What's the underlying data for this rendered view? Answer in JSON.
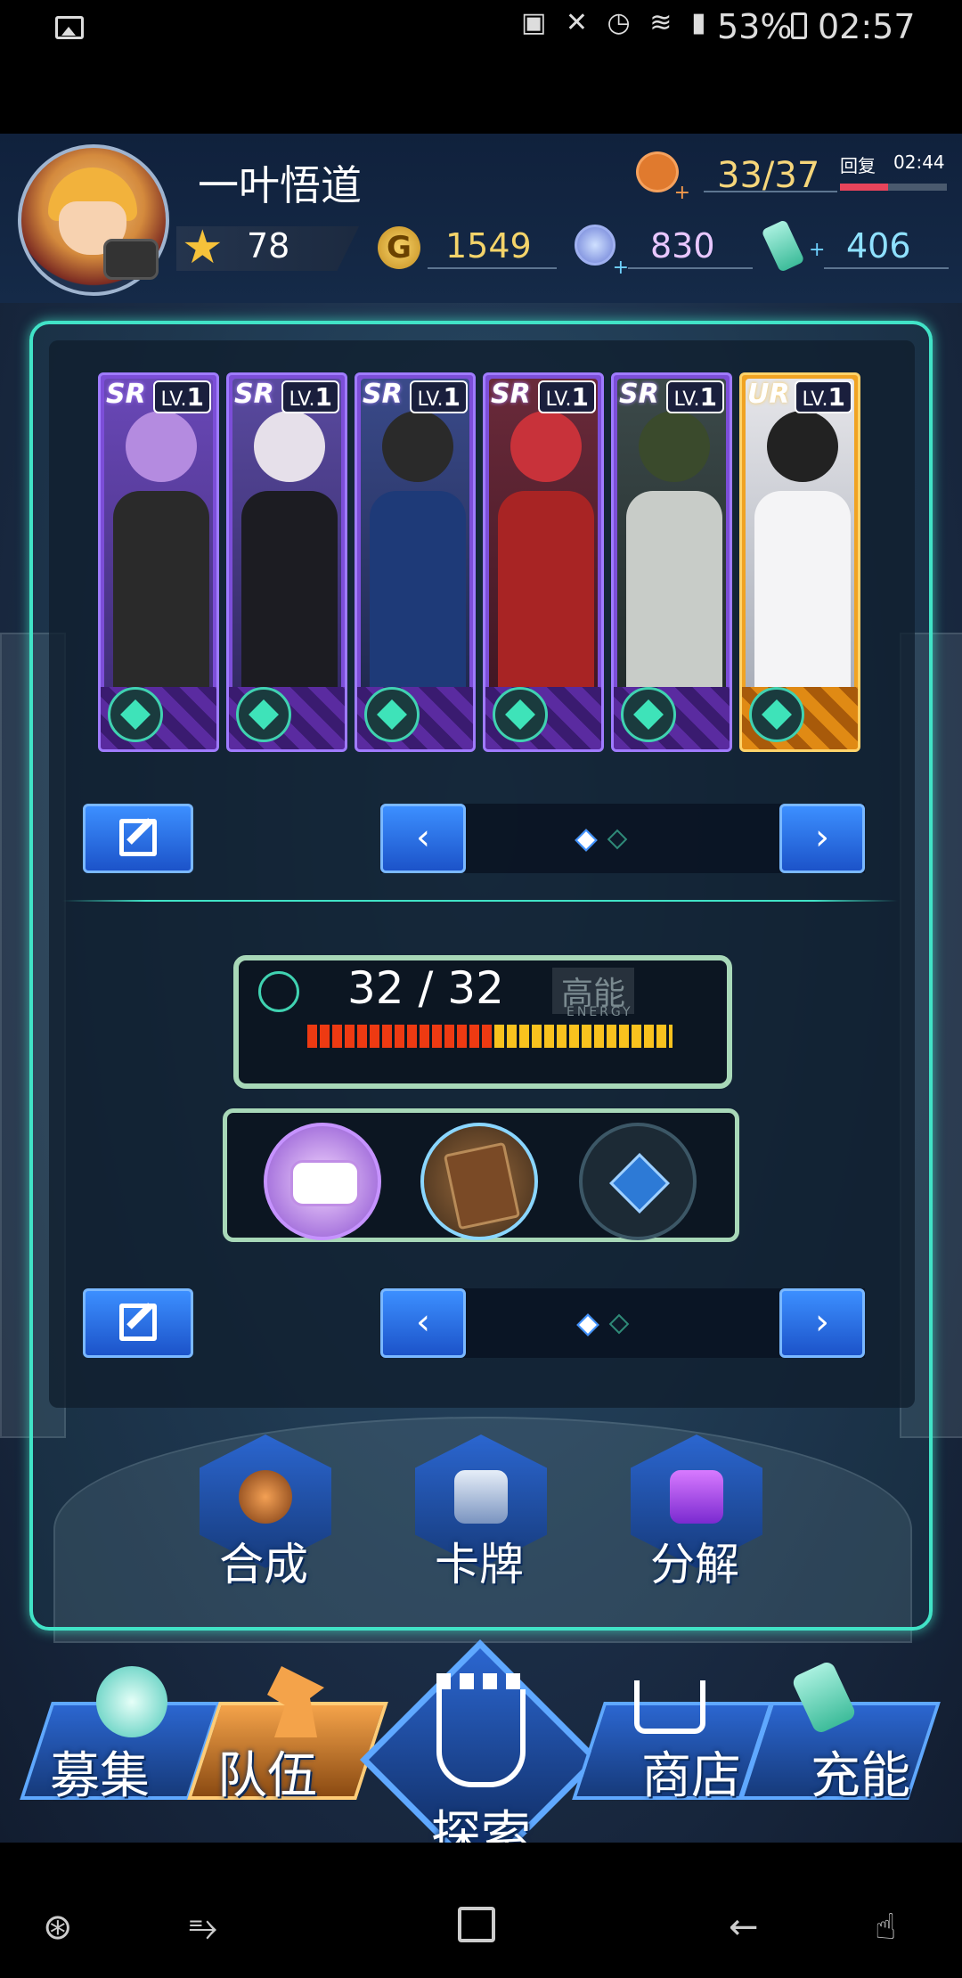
{
  "status_bar": {
    "battery": "53%",
    "time": "02:57",
    "icons": [
      "gallery-icon",
      "screenshot-icon",
      "mute-icon",
      "alarm-icon",
      "wifi-icon",
      "4g-signal-icon",
      "battery-icon"
    ]
  },
  "header": {
    "player_name": "一叶悟道",
    "stamina": "33/37",
    "recover_label": "回复",
    "recover_time": "02:44",
    "recover_progress": 0.45,
    "level_stars": "78",
    "gold": "1549",
    "gems": "830",
    "energy_items": "406"
  },
  "team": {
    "cards": [
      {
        "rarity": "SR",
        "level_prefix": "LV.",
        "level": "1"
      },
      {
        "rarity": "SR",
        "level_prefix": "LV.",
        "level": "1"
      },
      {
        "rarity": "SR",
        "level_prefix": "LV.",
        "level": "1"
      },
      {
        "rarity": "SR",
        "level_prefix": "LV.",
        "level": "1"
      },
      {
        "rarity": "SR",
        "level_prefix": "LV.",
        "level": "1"
      },
      {
        "rarity": "UR",
        "level_prefix": "LV.",
        "level": "1"
      }
    ],
    "pager_prev": "‹",
    "pager_next": "›",
    "page_index": 1,
    "page_count": 2
  },
  "energy": {
    "count": "32 / 32",
    "tag": "高能",
    "tag_sub": "ENERGY",
    "fill": 1.0
  },
  "equipment": {
    "slots": [
      "game-console-icon",
      "book-icon",
      "lock-icon"
    ],
    "pager_prev": "‹",
    "pager_next": "›"
  },
  "actions": {
    "synthesize": "合成",
    "cards": "卡牌",
    "decompose": "分解"
  },
  "nav": {
    "recruit": "募集",
    "team": "队伍",
    "explore": "探索",
    "shop": "商店",
    "recharge": "充能",
    "active": "team"
  },
  "colors": {
    "accent": "#41e3c7",
    "button_blue": "#2b66d0",
    "active_tab": "#f4a34a",
    "gold_text": "#f4d46a",
    "stamina_bar": "#e8445b"
  }
}
